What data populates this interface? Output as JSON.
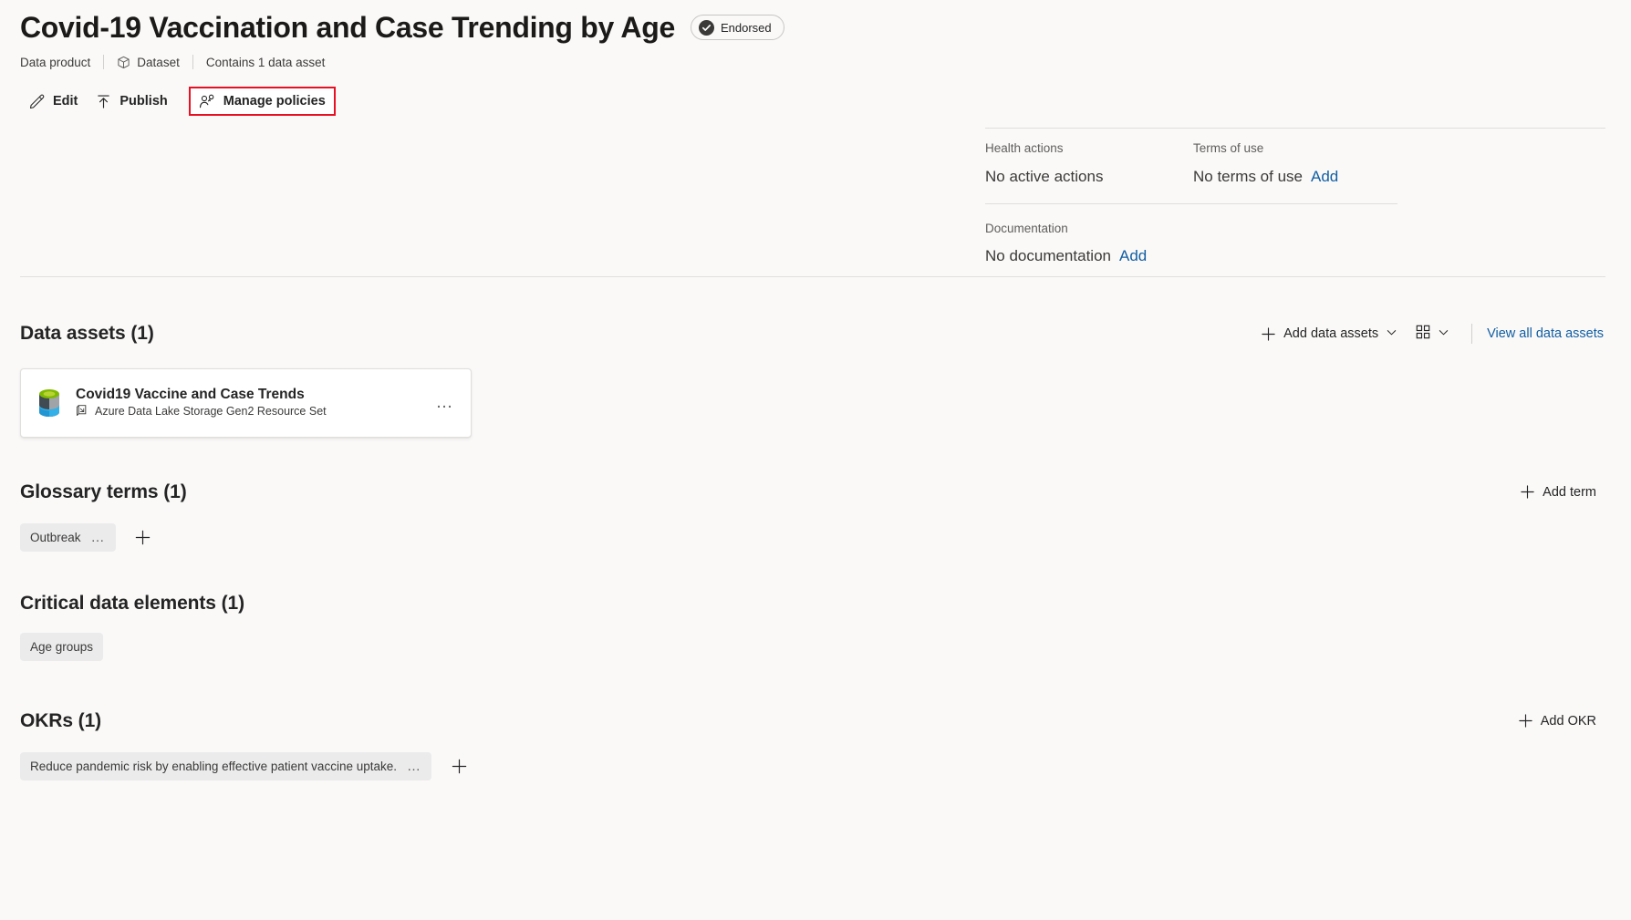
{
  "header": {
    "title": "Covid-19 Vaccination and Case Trending by Age",
    "endorsed_label": "Endorsed",
    "breadcrumb": {
      "kind": "Data product",
      "type": "Dataset",
      "contains": "Contains 1 data asset"
    }
  },
  "toolbar": {
    "edit_label": "Edit",
    "publish_label": "Publish",
    "manage_policies_label": "Manage policies",
    "highlight_color": "#e81123"
  },
  "info": {
    "health": {
      "label": "Health actions",
      "value": "No active actions"
    },
    "terms": {
      "label": "Terms of use",
      "value": "No terms of use",
      "add_label": "Add"
    },
    "documentation": {
      "label": "Documentation",
      "value": "No documentation",
      "add_label": "Add"
    }
  },
  "data_assets": {
    "title": "Data assets (1)",
    "add_label": "Add data assets",
    "view_all_label": "View all data assets",
    "items": [
      {
        "name": "Covid19 Vaccine and Case Trends",
        "type": "Azure Data Lake Storage Gen2 Resource Set",
        "icon": "azure-data-lake-icon",
        "more_label": "…"
      }
    ]
  },
  "glossary": {
    "title": "Glossary terms (1)",
    "add_label": "Add term",
    "terms": [
      "Outbreak"
    ]
  },
  "critical_data_elements": {
    "title": "Critical data elements (1)",
    "items": [
      "Age groups"
    ]
  },
  "okrs": {
    "title": "OKRs (1)",
    "add_label": "Add OKR",
    "items": [
      "Reduce pandemic risk by enabling effective patient vaccine uptake."
    ]
  },
  "colors": {
    "link": "#115ea3",
    "background": "#faf9f8",
    "chip": "#ebebeb",
    "divider": "#e1dfdd"
  }
}
